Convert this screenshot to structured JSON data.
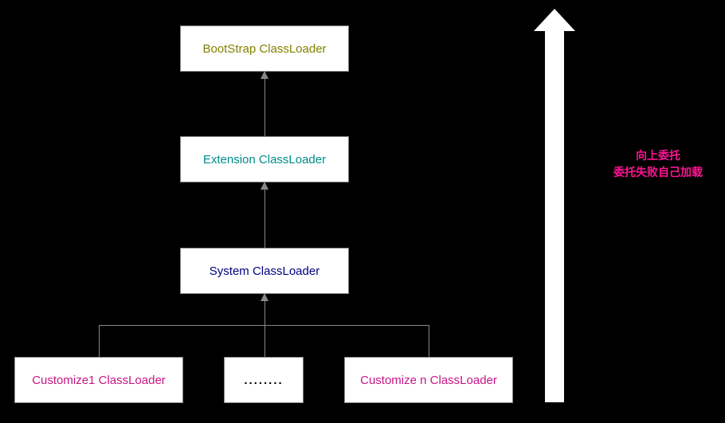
{
  "nodes": {
    "bootstrap": "BootStrap ClassLoader",
    "extension": "Extension ClassLoader",
    "system": "System  ClassLoader",
    "customize1": "Customize1 ClassLoader",
    "dots": "........",
    "customizeN": "Customize n ClassLoader"
  },
  "annotation": {
    "line1": "向上委托",
    "line2": "委托失败自己加载"
  },
  "diagram": {
    "type": "hierarchy",
    "title": "Java ClassLoader Parent Delegation",
    "levels": [
      {
        "id": "bootstrap",
        "label": "BootStrap ClassLoader",
        "color": "#808000"
      },
      {
        "id": "extension",
        "label": "Extension ClassLoader",
        "color": "#008b8b"
      },
      {
        "id": "system",
        "label": "System ClassLoader",
        "color": "#000080"
      },
      {
        "id": "custom",
        "children": [
          "Customize1 ClassLoader",
          "........",
          "Customize n ClassLoader"
        ],
        "color": "#c71585"
      }
    ],
    "edges": [
      {
        "from": "extension",
        "to": "bootstrap",
        "direction": "up"
      },
      {
        "from": "system",
        "to": "extension",
        "direction": "up"
      },
      {
        "from": "custom",
        "to": "system",
        "direction": "up"
      }
    ],
    "big_arrow_meaning": "向上委托 / 委托失败自己加载"
  }
}
